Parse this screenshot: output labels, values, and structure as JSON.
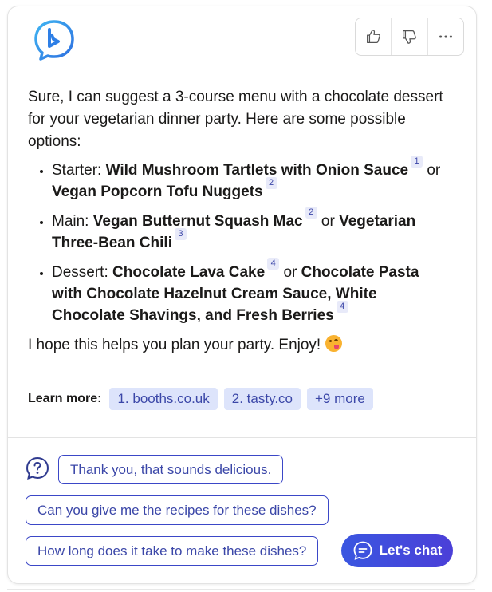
{
  "intro": "Sure, I can suggest a 3-course menu with a chocolate dessert for your vegetarian dinner party. Here are some possible options:",
  "courses": [
    {
      "prefix": "Starter: ",
      "opt1": "Wild Mushroom Tartlets with Onion Sauce",
      "ref1": "1",
      "joiner": " or ",
      "opt2": "Vegan Popcorn Tofu Nuggets",
      "ref2": "2"
    },
    {
      "prefix": "Main: ",
      "opt1": "Vegan Butternut Squash Mac",
      "ref1": "2",
      "joiner": " or ",
      "opt2": "Vegetarian Three-Bean Chili",
      "ref2": "3"
    },
    {
      "prefix": "Dessert: ",
      "opt1": "Chocolate Lava Cake",
      "ref1": "4",
      "joiner": " or ",
      "opt2": "Chocolate Pasta with Chocolate Hazelnut Cream Sauce, White Chocolate Shavings, and Fresh Berries",
      "ref2": "4"
    }
  ],
  "closing": "I hope this helps you plan your party. Enjoy!",
  "emoji": "face-savoring-food-emoji",
  "learn_more": {
    "label": "Learn more:",
    "links": [
      "1. booths.co.uk",
      "2. tasty.co",
      "+9 more"
    ]
  },
  "suggestions": [
    "Thank you, that sounds delicious.",
    "Can you give me the recipes for these dishes?",
    "How long does it take to make these dishes?"
  ],
  "cta": {
    "label": "Let's chat"
  },
  "icons": {
    "logo": "bing-logo-icon",
    "like": "thumbs-up-icon",
    "dislike": "thumbs-down-icon",
    "more": "more-options-icon",
    "help": "question-bubble-icon",
    "chat": "chat-bubble-icon"
  },
  "colors": {
    "accent": "#3b47c7",
    "chip_bg": "#dde4fb",
    "cta_start": "#3a56e0",
    "cta_end": "#4b3fd8"
  }
}
